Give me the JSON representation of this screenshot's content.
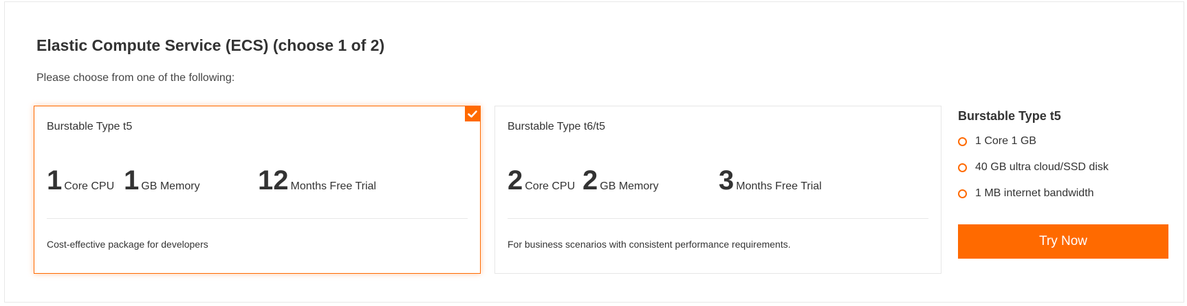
{
  "header": {
    "title": "Elastic Compute Service (ECS) (choose 1 of 2)",
    "subtitle": "Please choose from one of the following:"
  },
  "colors": {
    "accent": "#ff6a00",
    "border": "#e6e6e6",
    "text": "#333333"
  },
  "cards": [
    {
      "name": "Burstable Type t5",
      "selected": true,
      "cpu_value": "1",
      "cpu_unit": "Core CPU",
      "memory_value": "1",
      "memory_unit": "GB Memory",
      "trial_value": "12",
      "trial_unit": "Months Free Trial",
      "description": "Cost-effective package for developers"
    },
    {
      "name": "Burstable Type t6/t5",
      "selected": false,
      "cpu_value": "2",
      "cpu_unit": "Core CPU",
      "memory_value": "2",
      "memory_unit": "GB Memory",
      "trial_value": "3",
      "trial_unit": "Months Free Trial",
      "description": "For business scenarios with consistent performance requirements."
    }
  ],
  "summary": {
    "title": "Burstable Type t5",
    "features": [
      "1 Core 1 GB",
      "40 GB ultra cloud/SSD disk",
      "1 MB internet bandwidth"
    ],
    "button_label": "Try Now"
  },
  "icons": {
    "selected_check": "check-icon",
    "feature_bullet": "circle-bullet-icon"
  }
}
